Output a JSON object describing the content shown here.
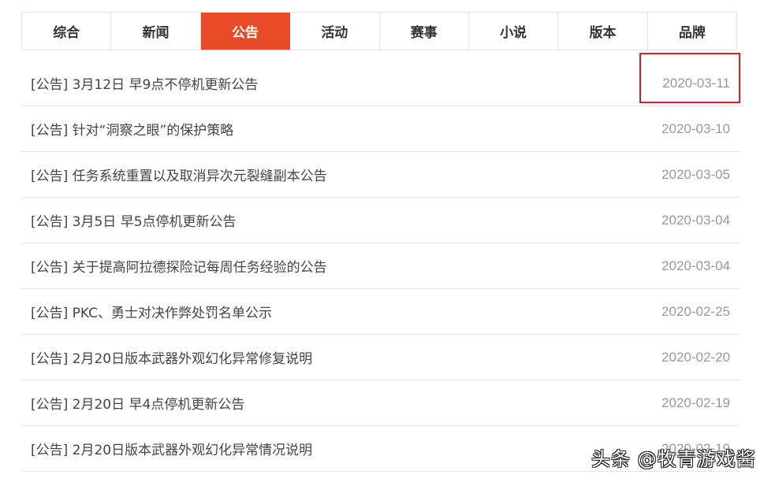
{
  "tabs": [
    {
      "label": "综合"
    },
    {
      "label": "新闻"
    },
    {
      "label": "公告"
    },
    {
      "label": "活动"
    },
    {
      "label": "赛事"
    },
    {
      "label": "小说"
    },
    {
      "label": "版本"
    },
    {
      "label": "品牌"
    }
  ],
  "active_tab": "公告",
  "items": [
    {
      "title": "[公告] 3月12日 早9点不停机更新公告",
      "date": "2020-03-11"
    },
    {
      "title": "[公告] 针对“洞察之眼”的保护策略",
      "date": "2020-03-10"
    },
    {
      "title": "[公告] 任务系统重置以及取消异次元裂缝副本公告",
      "date": "2020-03-05"
    },
    {
      "title": "[公告] 3月5日 早5点停机更新公告",
      "date": "2020-03-04"
    },
    {
      "title": "[公告] 关于提高阿拉德探险记每周任务经验的公告",
      "date": "2020-03-04"
    },
    {
      "title": "[公告] PKC、勇士对决作弊处罚名单公示",
      "date": "2020-02-25"
    },
    {
      "title": "[公告] 2月20日版本武器外观幻化异常修复说明",
      "date": "2020-02-20"
    },
    {
      "title": "[公告] 2月20日 早4点停机更新公告",
      "date": "2020-02-19"
    },
    {
      "title": "[公告] 2月20日版本武器外观幻化异常情况说明",
      "date": "2020-02-19"
    }
  ],
  "watermark": "头条 @牧青游戏酱",
  "colors": {
    "accent": "#ea4a27",
    "highlight_box": "#e02020"
  }
}
